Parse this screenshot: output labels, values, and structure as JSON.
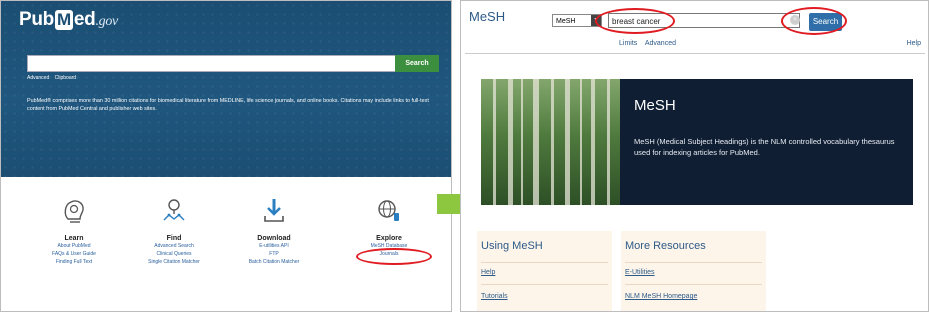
{
  "pubmed": {
    "logo_pub": "Pub",
    "logo_m": "M",
    "logo_ed": "ed",
    "logo_gov": ".gov",
    "search_button": "Search",
    "search_value": "",
    "sublinks": [
      "Advanced",
      "Clipboard"
    ],
    "description": "PubMed® comprises more than 30 million citations for biomedical literature from MEDLINE, life science journals, and online books. Citations may include links to full-text content from PubMed Central and publisher web sites.",
    "columns": [
      {
        "heading": "Learn",
        "icon": "lightbulb-head-icon",
        "links": [
          "About PubMed",
          "FAQs & User Guide",
          "Finding Full Text"
        ]
      },
      {
        "heading": "Find",
        "icon": "search-network-icon",
        "links": [
          "Advanced Search",
          "Clinical Queries",
          "Single Citation Matcher"
        ]
      },
      {
        "heading": "Download",
        "icon": "download-icon",
        "links": [
          "E-utilities API",
          "FTP",
          "Batch Citation Matcher"
        ]
      },
      {
        "heading": "Explore",
        "icon": "globe-icon",
        "links": [
          "MeSH Database",
          "Journals"
        ]
      }
    ]
  },
  "mesh": {
    "header_title": "MeSH",
    "db_select": "MeSH",
    "search_value": "breast cancer",
    "search_button": "Search",
    "limits": "Limits",
    "advanced": "Advanced",
    "help": "Help",
    "banner_title": "MeSH",
    "banner_text": "MeSH (Medical Subject Headings) is the NLM controlled vocabulary thesaurus used for indexing articles for PubMed.",
    "using_heading": "Using MeSH",
    "using_links": [
      "Help",
      "Tutorials"
    ],
    "resources_heading": "More Resources",
    "resources_links": [
      "E-Utilities",
      "NLM MeSH Homepage"
    ]
  },
  "colors": {
    "pubmed_blue": "#1b4e72",
    "search_green": "#3c8f3e",
    "highlight_red": "#e01b22",
    "arrow_green": "#8dc63f",
    "mesh_link": "#2d5a88"
  }
}
